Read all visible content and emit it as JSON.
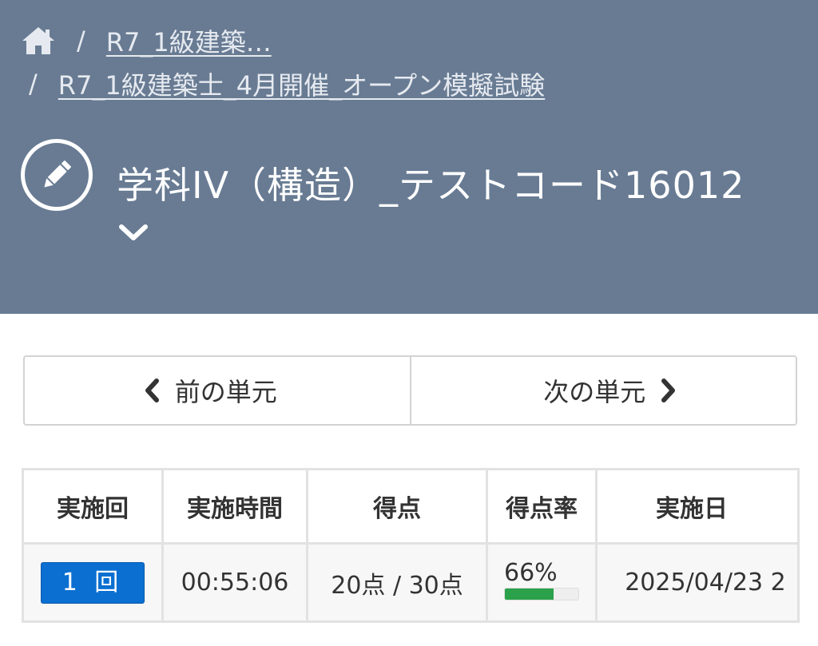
{
  "breadcrumb": {
    "home_icon": "home-icon",
    "separator": "/",
    "parent_label": "R7_1級建築…",
    "current_label": "R7_1級建築士_4月開催_オープン模擬試験"
  },
  "page": {
    "icon": "pencil-icon",
    "title": "学科IV（構造）_テストコード16012",
    "expand_icon": "chevron-down-icon"
  },
  "unit_nav": {
    "prev_label": "前の単元",
    "next_label": "次の単元"
  },
  "results_table": {
    "headers": [
      "実施回",
      "実施時間",
      "得点",
      "得点率",
      "実施日"
    ],
    "rows": [
      {
        "attempt": "1 回",
        "duration": "00:55:06",
        "score": "20点 / 30点",
        "rate": "66%",
        "rate_fraction": 0.66,
        "date": "2025/04/23 2"
      }
    ]
  },
  "colors": {
    "header_bg": "#687b93",
    "attempt_button": "#0a6fd1",
    "progress_fill": "#2aa14a"
  }
}
